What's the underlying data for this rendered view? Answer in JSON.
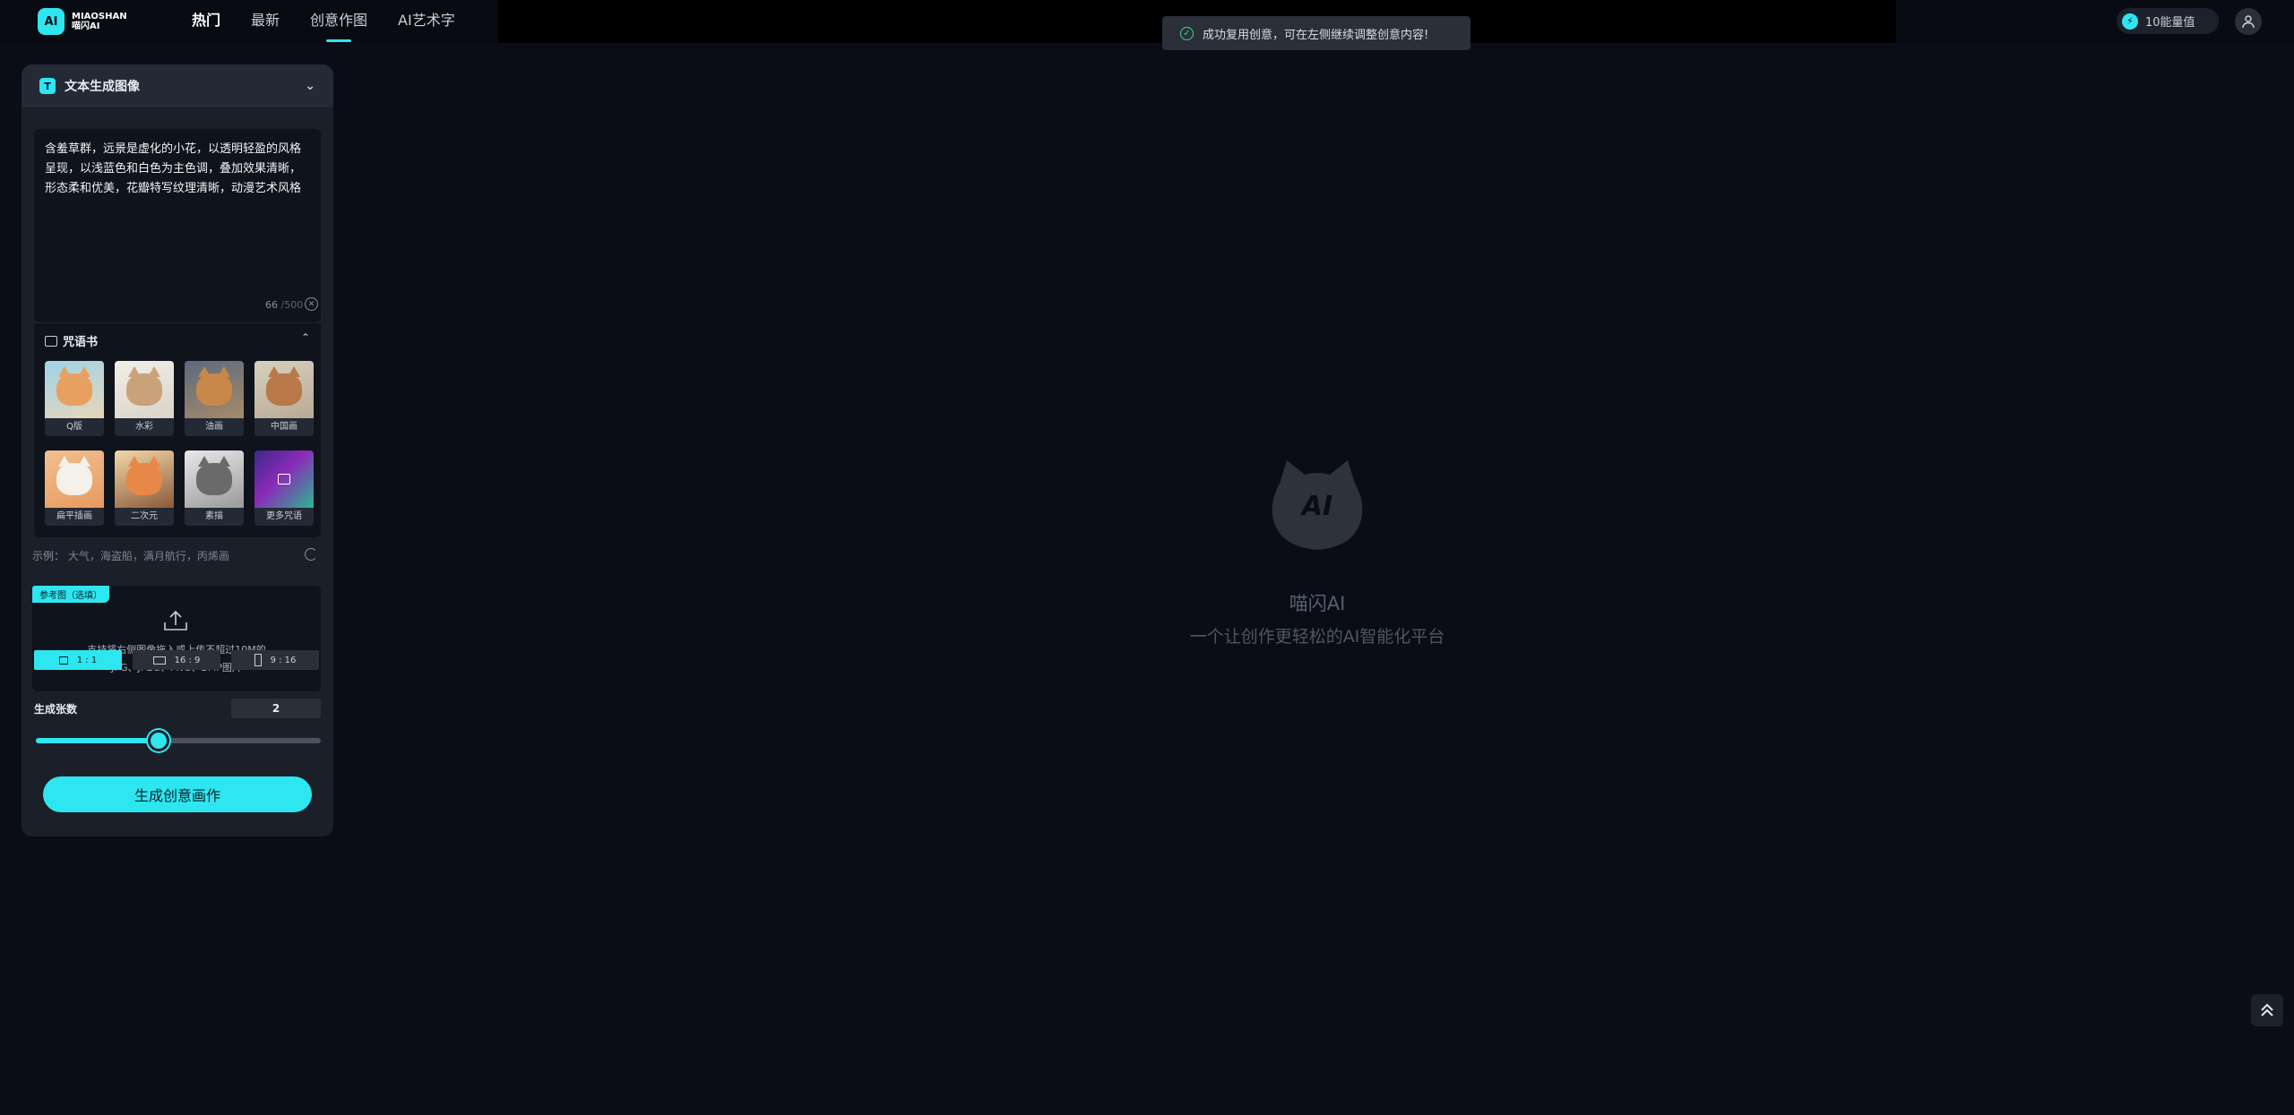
{
  "logo": {
    "badge": "AI",
    "name_en": "MIAOSHAN",
    "name_cn": "喵闪AI"
  },
  "nav": {
    "tabs": [
      "热门",
      "最新",
      "创意作图",
      "AI艺术字"
    ]
  },
  "toast": {
    "message": "成功复用创意，可在左侧继续调整创意内容!"
  },
  "energy": {
    "label": "10能量值"
  },
  "panel": {
    "mode_label": "文本生成图像",
    "prompt_text": "含羞草群，远景是虚化的小花，以透明轻盈的风格呈现，以浅蓝色和白色为主色调，叠加效果清晰，形态柔和优美，花瓣特写纹理清晰，动漫艺术风格",
    "char_count": "66",
    "char_max": "/500",
    "spellbook_title": "咒语书",
    "styles": [
      "Q版",
      "水彩",
      "油画",
      "中国画",
      "扁平插画",
      "二次元",
      "素描",
      "更多咒语"
    ],
    "example_label": "示例：",
    "examples": "大气，海盗船，满月航行，丙烯画",
    "reference": {
      "tag": "参考图（选填）",
      "hint_line1": "支持将右侧图像拖入或上传不超过10M的",
      "hint_line2": "JPG、JPEG、PNG、BMP图片"
    },
    "ratios": [
      "1 : 1",
      "16 : 9",
      "9 : 16"
    ],
    "count_label": "生成张数",
    "count_value": "2",
    "slider_fraction": 0.43,
    "generate_label": "生成创意画作"
  },
  "empty_state": {
    "mascot_text": "AI",
    "brand": "喵闪AI",
    "slogan": "一个让创作更轻松的AI智能化平台"
  },
  "colors": {
    "accent": "#2ee6f0",
    "background": "#0a0d16",
    "panel": "#1a1f29",
    "success": "#3ddc84"
  }
}
